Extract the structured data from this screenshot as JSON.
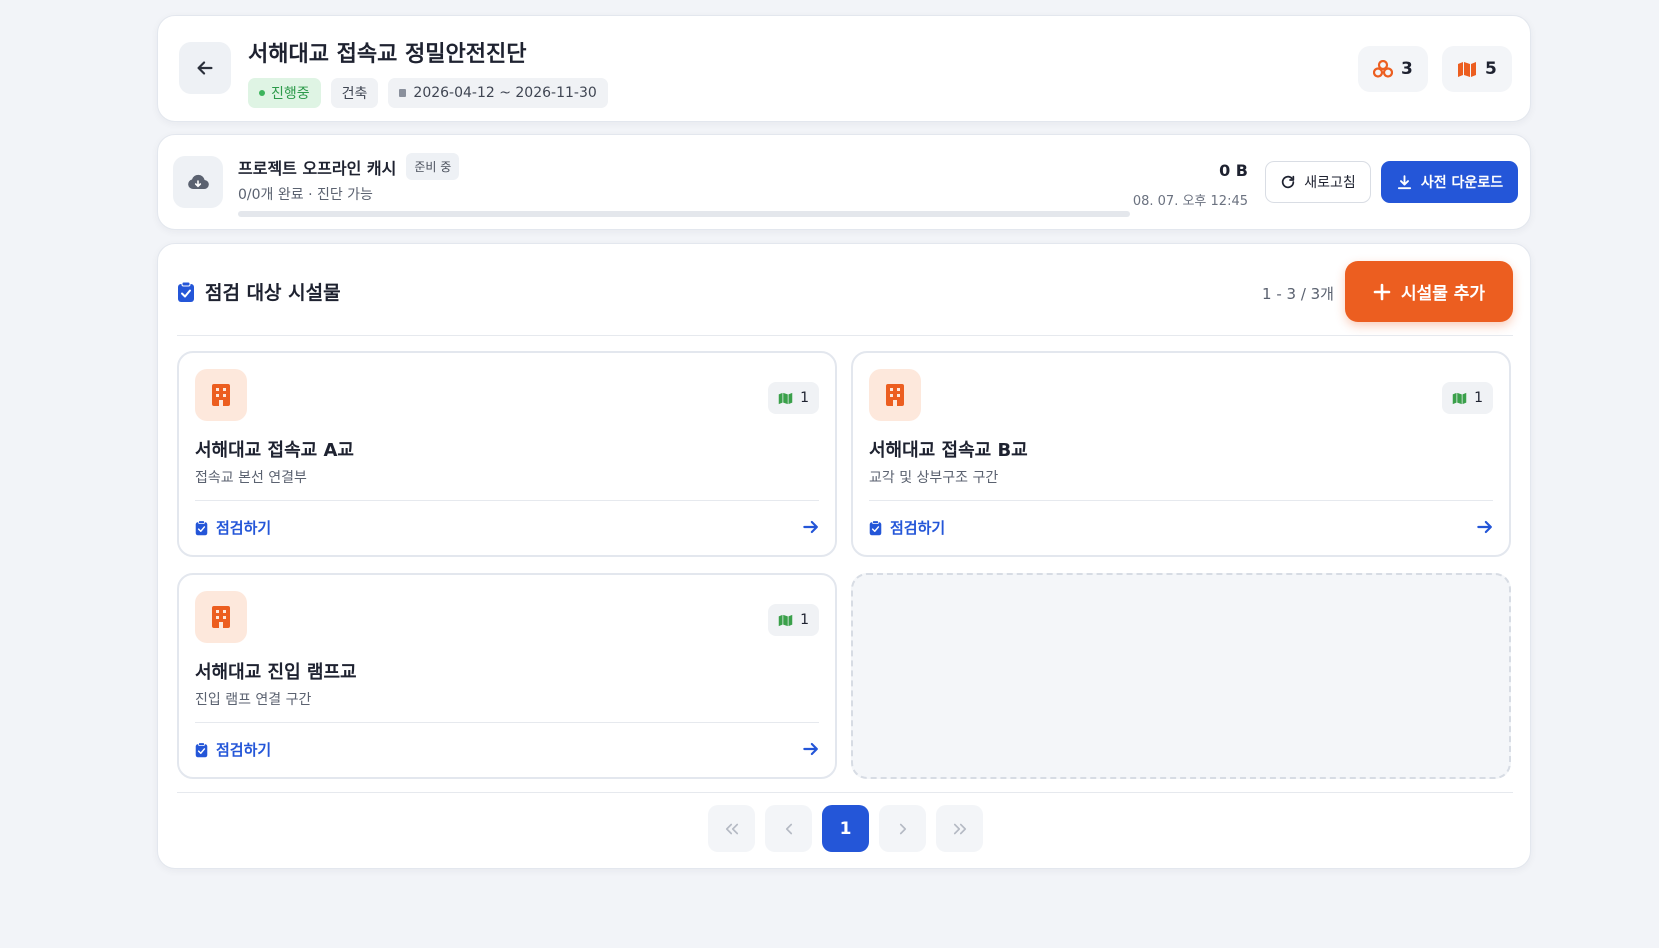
{
  "header": {
    "title": "서해대교 접속교 정밀안전진단",
    "status": "진행중",
    "category": "건축",
    "period": "2026-04-12 ~ 2026-11-30",
    "facility_count": "3",
    "map_count": "5"
  },
  "cache": {
    "title": "프로젝트 오프라인 캐시",
    "badge": "준비 중",
    "subtitle": "0/0개 완료 · 진단 가능",
    "size": "0 B",
    "updated": "08. 07. 오후 12:45",
    "progress": 0,
    "refresh_label": "새로고침",
    "download_label": "사전 다운로드"
  },
  "facilities": {
    "title": "점검 대상 시설물",
    "range": "1 - 3 / 3개",
    "add_label": "시설물 추가",
    "items": [
      {
        "name": "서해대교 접속교 A교",
        "desc": "접속교 본선 연결부",
        "maps": "1",
        "action": "점검하기"
      },
      {
        "name": "서해대교 접속교 B교",
        "desc": "교각 및 상부구조 구간",
        "maps": "1",
        "action": "점검하기"
      },
      {
        "name": "서해대교 진입 램프교",
        "desc": "진입 램프 연결 구간",
        "maps": "1",
        "action": "점검하기"
      }
    ]
  },
  "pagination": {
    "current": "1"
  },
  "colors": {
    "primary": "#2456d8",
    "accent_orange": "#ec5e20",
    "status_green": "#2c9a4a",
    "map_green": "#3aa04a"
  }
}
